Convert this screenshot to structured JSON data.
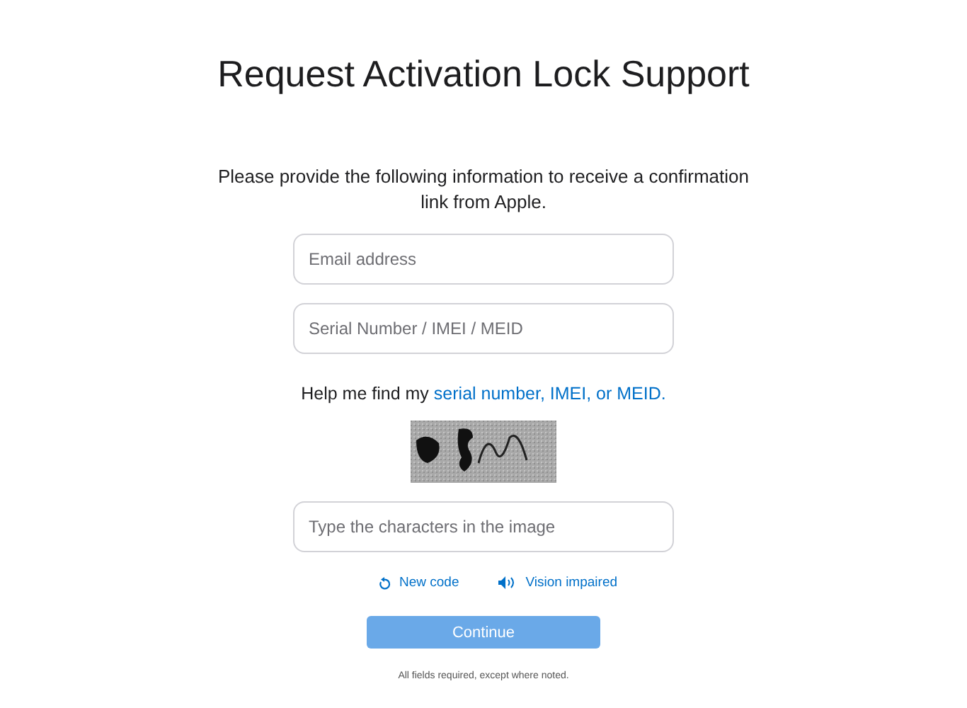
{
  "title": "Request Activation Lock Support",
  "intro": "Please provide the following information to receive a confirmation link from Apple.",
  "fields": [
    {
      "placeholder": "Email address"
    },
    {
      "placeholder": "Serial Number / IMEI / MEID"
    }
  ],
  "help": {
    "text": "Help me find my",
    "link": "serial number, IMEI, or MEID."
  },
  "captcha_field": {
    "placeholder": "Type the characters in the image"
  },
  "captcha_links": [
    {
      "kind": "refresh",
      "label": "New code"
    },
    {
      "kind": "audio",
      "label": "Vision impaired"
    }
  ],
  "continue_button": {
    "label": "Continue",
    "disabled": true
  },
  "footnote": "All fields required, except where noted."
}
